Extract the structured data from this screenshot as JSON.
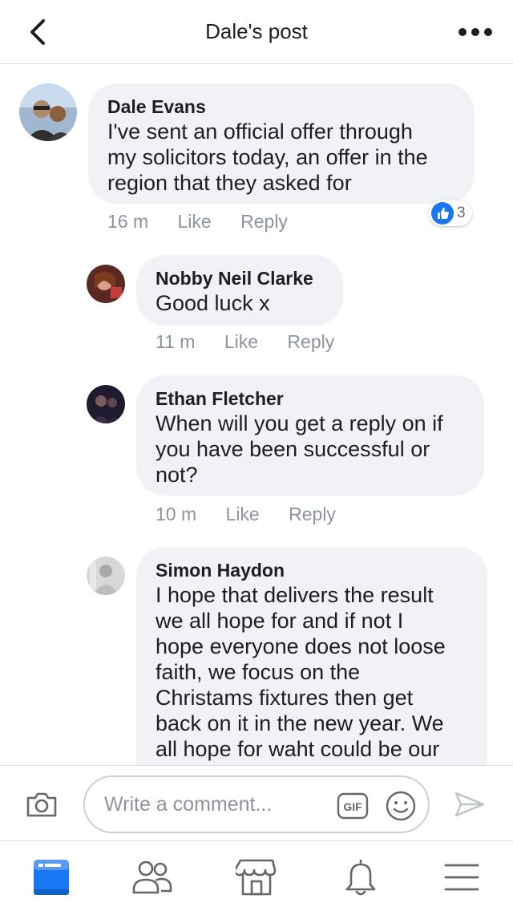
{
  "header": {
    "title": "Dale's post",
    "back_icon": "chevron-left-icon",
    "more_icon": "more-horizontal-icon"
  },
  "comments": [
    {
      "author": "Dale Evans",
      "lines": [
        "I've sent an official offer through",
        "my solicitors today, an offer in the",
        "region that they asked for"
      ],
      "time": "16 m",
      "like": "Like",
      "reply": "Reply",
      "reaction_count": "3"
    },
    {
      "author": "Nobby Neil Clarke",
      "lines": [
        "Good luck x"
      ],
      "time": "11 m",
      "like": "Like",
      "reply": "Reply"
    },
    {
      "author": "Ethan Fletcher",
      "lines": [
        "When will you get a reply on if",
        "you have been successful or",
        "not?"
      ],
      "time": "10 m",
      "like": "Like",
      "reply": "Reply"
    },
    {
      "author": "Simon Haydon",
      "lines": [
        "I hope that delivers the result",
        "we all hope for and if not I",
        "hope everyone does not loose",
        "faith, we focus on the",
        "Christams fixtures then get",
        "back on it in the new year. We",
        "all hope for waht could be our"
      ]
    }
  ],
  "composer": {
    "placeholder": "Write a comment...",
    "gif_label": "GIF"
  },
  "tabs": [
    "news-feed-icon",
    "friends-icon",
    "marketplace-icon",
    "notifications-icon",
    "menu-icon"
  ],
  "colors": {
    "accent": "#1877f2",
    "bubble": "#f0f2f5",
    "meta": "#8d949e"
  }
}
